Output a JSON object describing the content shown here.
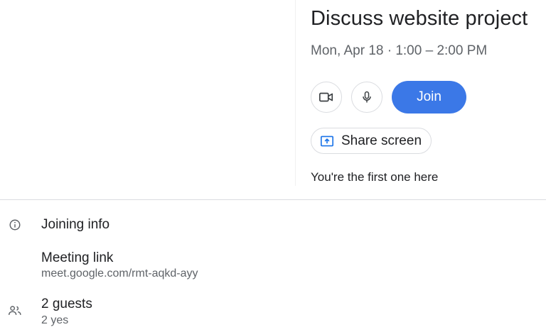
{
  "event": {
    "title": "Discuss website project",
    "datetime": "Mon, Apr 18 · 1:00 – 2:00 PM"
  },
  "controls": {
    "camera_icon": "video-camera-icon",
    "mic_icon": "microphone-icon",
    "join_label": "Join",
    "share_label": "Share screen",
    "share_icon": "present-to-all-icon"
  },
  "status": "You're the first one here",
  "details": {
    "joining_title": "Joining info",
    "joining_icon": "info-icon",
    "meeting_link_label": "Meeting link",
    "meeting_link_url": "meet.google.com/rmt-aqkd-ayy",
    "guests_title": "2 guests",
    "guests_summary": "2 yes",
    "guests_icon": "people-icon"
  },
  "colors": {
    "accent": "#3b78e7",
    "text_primary": "#202124",
    "text_secondary": "#5f6368",
    "divider": "#dadce0"
  }
}
